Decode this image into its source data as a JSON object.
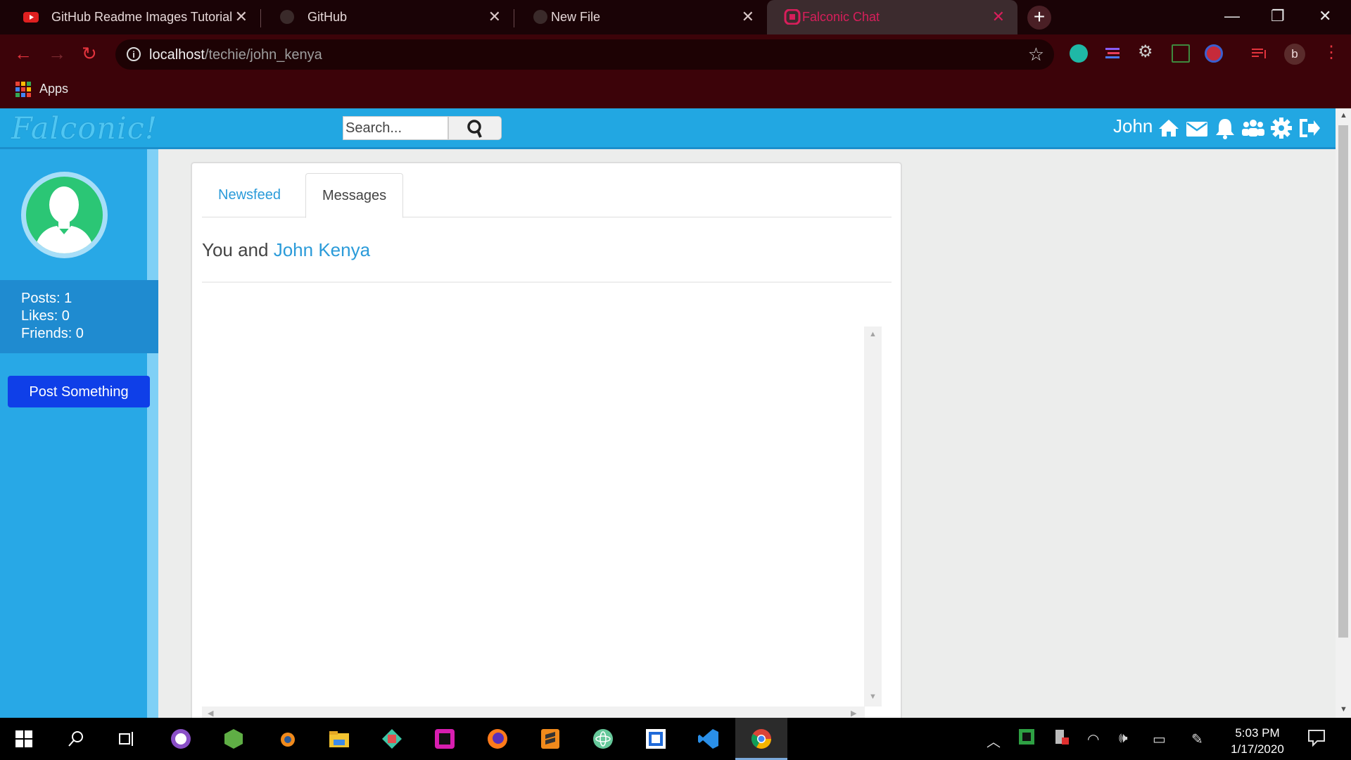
{
  "browser": {
    "tabs": [
      {
        "title": "GitHub Readme Images Tutorial (",
        "icon": "youtube-icon",
        "active": false
      },
      {
        "title": "GitHub",
        "icon": "github-icon",
        "active": false
      },
      {
        "title": "New File",
        "icon": "github-icon",
        "active": false
      },
      {
        "title": "Falconic Chat",
        "icon": "falconic-icon",
        "active": true
      }
    ],
    "url_host": "localhost",
    "url_path": "/techie/john_kenya",
    "bookmarks": {
      "apps_label": "Apps"
    },
    "profile_initial": "b",
    "accent": "#d81e5b"
  },
  "site": {
    "logo": "Falconic!",
    "search_placeholder": "Search...",
    "username": "John",
    "header_color": "#22a7e2",
    "header_icons": [
      "home-icon",
      "envelope-icon",
      "bell-icon",
      "users-icon",
      "gear-icon",
      "logout-icon"
    ]
  },
  "sidebar": {
    "stats": {
      "posts": "Posts: 1",
      "likes": "Likes: 0",
      "friends": "Friends: 0"
    },
    "post_button": "Post Something"
  },
  "main": {
    "tabs": [
      {
        "label": "Newsfeed",
        "active": false
      },
      {
        "label": "Messages",
        "active": true
      }
    ],
    "conversation_prefix": "You and",
    "conversation_friend": "John Kenya"
  },
  "taskbar": {
    "time": "5:03 PM",
    "date": "1/17/2020",
    "apps": [
      "start-icon",
      "search-icon",
      "task-view-icon",
      "github-desktop-icon",
      "nodejs-icon",
      "blender-icon",
      "file-explorer-icon",
      "git-kraken-icon",
      "phpstorm-icon",
      "firefox-icon",
      "sublime-text-icon",
      "atom-icon",
      "intellij-icon",
      "vscode-icon",
      "chrome-icon"
    ]
  }
}
